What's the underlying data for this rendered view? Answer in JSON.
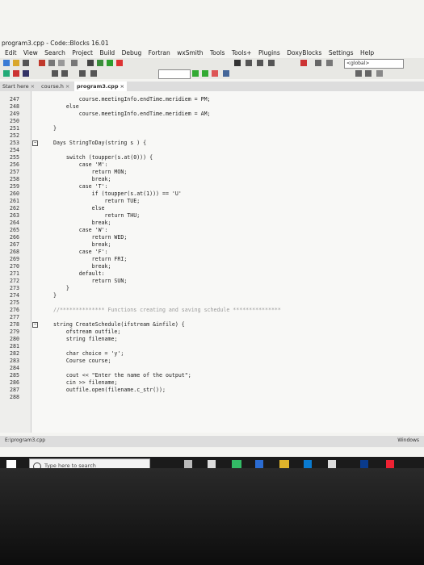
{
  "window": {
    "title": "program3.cpp - Code::Blocks 16.01",
    "menu": [
      "Edit",
      "View",
      "Search",
      "Project",
      "Build",
      "Debug",
      "Fortran",
      "wxSmith",
      "Tools",
      "Tools+",
      "Plugins",
      "DoxyBlocks",
      "Settings",
      "Help"
    ],
    "scope_selector": "<global>"
  },
  "tabs": {
    "start_label": "Start here",
    "items": [
      {
        "label": "course.h",
        "active": false
      },
      {
        "label": "program3.cpp",
        "active": true
      }
    ]
  },
  "editor": {
    "lines": [
      {
        "num": "247",
        "text": "        course.meetingInfo.endTime.meridiem = PM;"
      },
      {
        "num": "248",
        "text": "    else"
      },
      {
        "num": "249",
        "text": "        course.meetingInfo.endTime.meridiem = AM;"
      },
      {
        "num": "250",
        "text": ""
      },
      {
        "num": "251",
        "text": "}"
      },
      {
        "num": "252",
        "text": ""
      },
      {
        "num": "253",
        "text": "Days StringToDay(string s ) {"
      },
      {
        "num": "254",
        "text": ""
      },
      {
        "num": "255",
        "text": "    switch (toupper(s.at(0))) {"
      },
      {
        "num": "256",
        "text": "        case 'M':"
      },
      {
        "num": "257",
        "text": "            return MON;"
      },
      {
        "num": "258",
        "text": "            break;"
      },
      {
        "num": "259",
        "text": "        case 'T':"
      },
      {
        "num": "260",
        "text": "            if (toupper(s.at(1))) == 'U'"
      },
      {
        "num": "261",
        "text": "                return TUE;"
      },
      {
        "num": "262",
        "text": "            else"
      },
      {
        "num": "263",
        "text": "                return THU;"
      },
      {
        "num": "264",
        "text": "            break;"
      },
      {
        "num": "265",
        "text": "        case 'W':"
      },
      {
        "num": "266",
        "text": "            return WED;"
      },
      {
        "num": "267",
        "text": "            break;"
      },
      {
        "num": "268",
        "text": "        case 'F':"
      },
      {
        "num": "269",
        "text": "            return FRI;"
      },
      {
        "num": "270",
        "text": "            break;"
      },
      {
        "num": "271",
        "text": "        default:"
      },
      {
        "num": "272",
        "text": "            return SUN;"
      },
      {
        "num": "273",
        "text": "    }"
      },
      {
        "num": "274",
        "text": "}"
      },
      {
        "num": "275",
        "text": ""
      },
      {
        "num": "276",
        "text": "//************** Functions creating and saving schedule ***************"
      },
      {
        "num": "277",
        "text": ""
      },
      {
        "num": "278",
        "text": "string CreateSchedule(ifstream &infile) {"
      },
      {
        "num": "279",
        "text": "    ofstream outfile;"
      },
      {
        "num": "280",
        "text": "    string filename;"
      },
      {
        "num": "281",
        "text": ""
      },
      {
        "num": "282",
        "text": "    char choice = 'y';"
      },
      {
        "num": "283",
        "text": "    Course course;"
      },
      {
        "num": "284",
        "text": ""
      },
      {
        "num": "285",
        "text": "    cout << \"Enter the name of the output\";"
      },
      {
        "num": "286",
        "text": "    cin >> filename;"
      },
      {
        "num": "287",
        "text": "    outfile.open(filename.c_str());"
      },
      {
        "num": "288",
        "text": ""
      }
    ]
  },
  "status": {
    "file": "E:\\program3.cpp",
    "right": "Windows"
  },
  "taskbar": {
    "search_placeholder": "Type here to search"
  }
}
